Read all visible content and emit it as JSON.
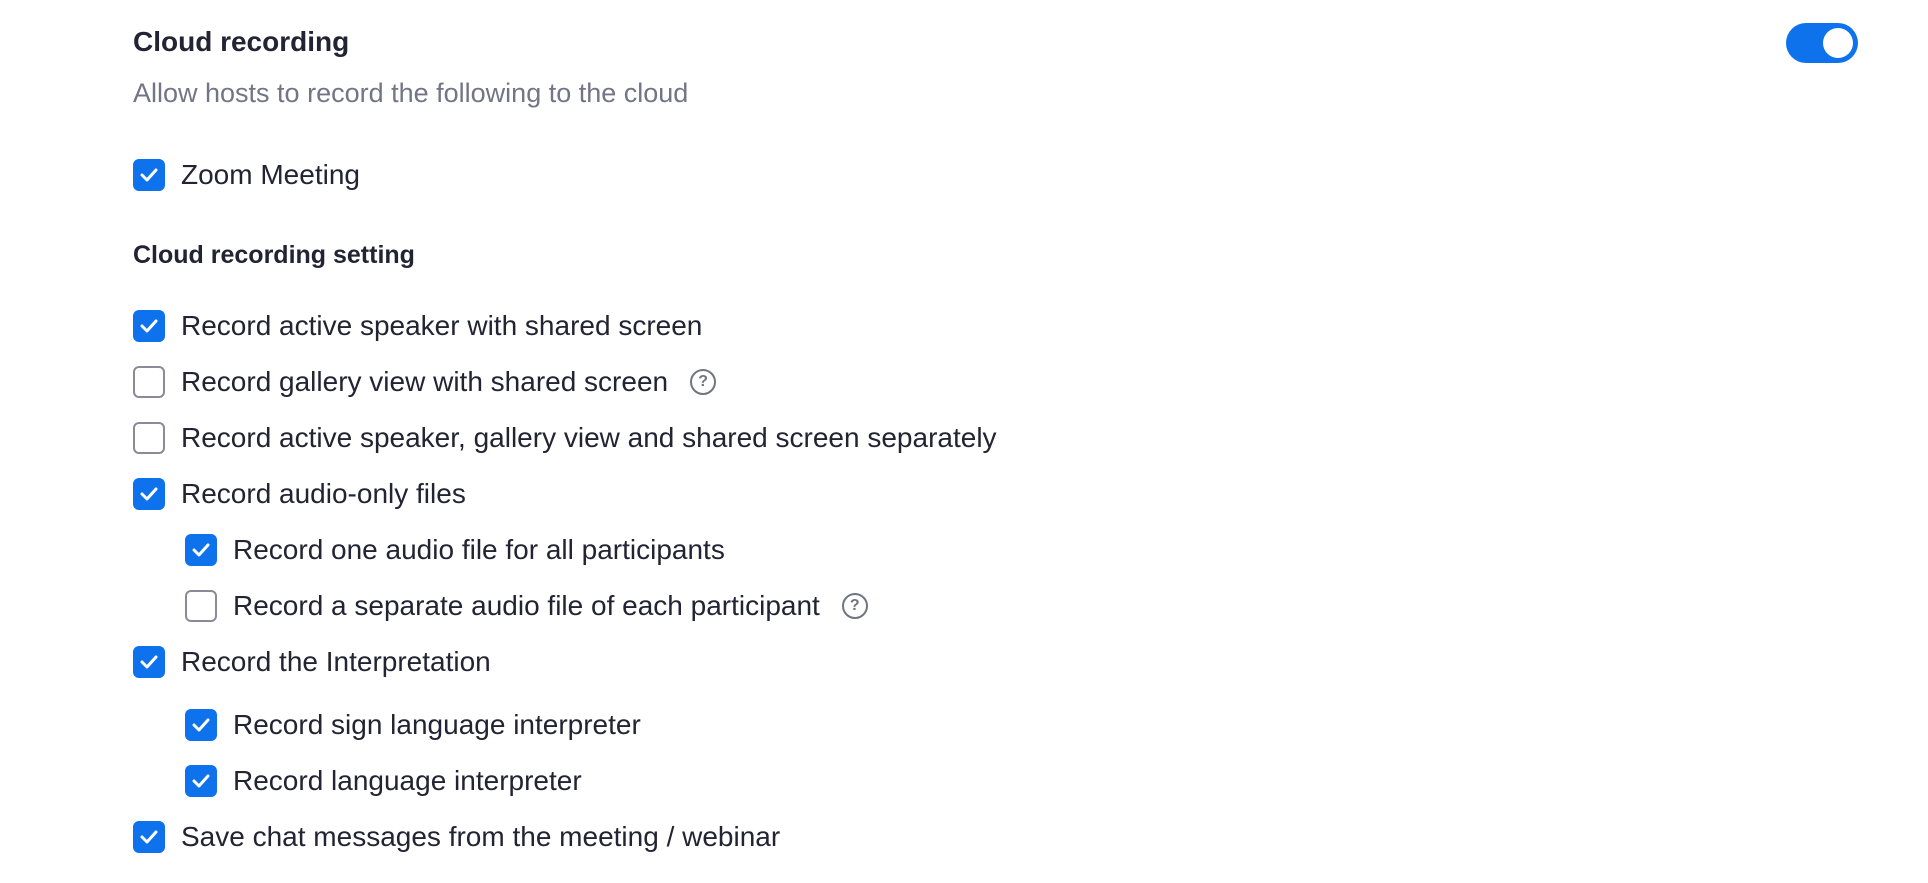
{
  "cloud_recording": {
    "title": "Cloud recording",
    "description": "Allow hosts to record the following to the cloud",
    "enabled": true,
    "accent_color": "#0e72ed",
    "zoom_meeting": {
      "label": "Zoom Meeting",
      "checked": true
    }
  },
  "settings": {
    "heading": "Cloud recording setting",
    "options": [
      {
        "label": "Record active speaker with shared screen",
        "checked": true,
        "level": 0,
        "help": false
      },
      {
        "label": "Record gallery view with shared screen",
        "checked": false,
        "level": 0,
        "help": true,
        "help_icon": "question-circle-icon",
        "help_glyph": "?"
      },
      {
        "label": "Record active speaker, gallery view and shared screen separately",
        "checked": false,
        "level": 0,
        "help": false
      },
      {
        "label": "Record audio-only files",
        "checked": true,
        "level": 0,
        "help": false
      },
      {
        "label": "Record one audio file for all participants",
        "checked": true,
        "level": 1,
        "help": false
      },
      {
        "label": "Record a separate audio file of each participant",
        "checked": false,
        "level": 1,
        "help": true,
        "help_icon": "question-circle-icon",
        "help_glyph": "?"
      },
      {
        "label": "Record the Interpretation",
        "checked": true,
        "level": 0,
        "help": false
      },
      {
        "label": "Record sign language interpreter",
        "checked": true,
        "level": 1,
        "help": false
      },
      {
        "label": "Record language interpreter",
        "checked": true,
        "level": 1,
        "help": false
      },
      {
        "label": "Save chat messages from the meeting / webinar",
        "checked": true,
        "level": 0,
        "help": false
      }
    ]
  }
}
